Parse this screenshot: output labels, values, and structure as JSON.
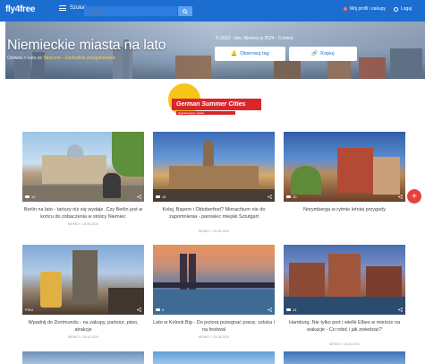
{
  "header": {
    "logo": "fly4free",
    "menu_label": "Szukaj",
    "search_placeholder": "Szukaj",
    "account_label": "Mój profil i zakupy",
    "profile_label": "Loguj"
  },
  "hero": {
    "title": "Niemieckie miasta na lato",
    "subtitle_prefix": "Główna > Lato ze",
    "subtitle_link": "Słońcem - Zachodnie przygotowanie",
    "meta": "© 2023 - lato, Niemcy w 2024 - 6 minut",
    "button_follow": "Obserwuj tag",
    "button_share": "Kopiuj"
  },
  "brand": {
    "banner": "German Summer Cities",
    "tagline": "Najpiękniejsze miasta"
  },
  "cards": [
    {
      "title": "Berlin na lato - tańszy niż się wydaje. Czy Berlin jest w końcu do zobaczenia w stolicy Niemiec",
      "meta": "NIEMCY • 24.06.2024",
      "badge": "12"
    },
    {
      "title": "Kolej, Bayern i Oktoberfest? Monachium nie do zapomnienia - parowiec miejski Sztutgart",
      "meta": "NIEMCY • 24.06.2024",
      "badge": "18"
    },
    {
      "title": "Norymberga w rytmie letniej przygody",
      "meta": "NIEMCY • 24.06.2024",
      "badge": "10"
    },
    {
      "title": "Wpadnij do Dortmundu - na zakupy, parkour, piwo, atrakcje",
      "meta": "NIEMCY • 24.06.2024",
      "badge": "PIKU"
    },
    {
      "title": "Lato w Kolonii Big - Do jeziora pożegnać pracę, sztuka i na festiwal",
      "meta": "NIEMCY • 24.06.2024",
      "badge": "9"
    },
    {
      "title": "Hamburg. Nie tylko port i wielki Elbes w mieście na wakacje - Co robić i jak zwiedzać?",
      "meta": "NIEMCY • 24.06.2024",
      "badge": "14"
    }
  ],
  "colors": {
    "primary": "#1c6dd0",
    "accent_red": "#d8262c",
    "sun": "#f5c518",
    "fab": "#e94040"
  },
  "fab_icon": "plus-icon"
}
